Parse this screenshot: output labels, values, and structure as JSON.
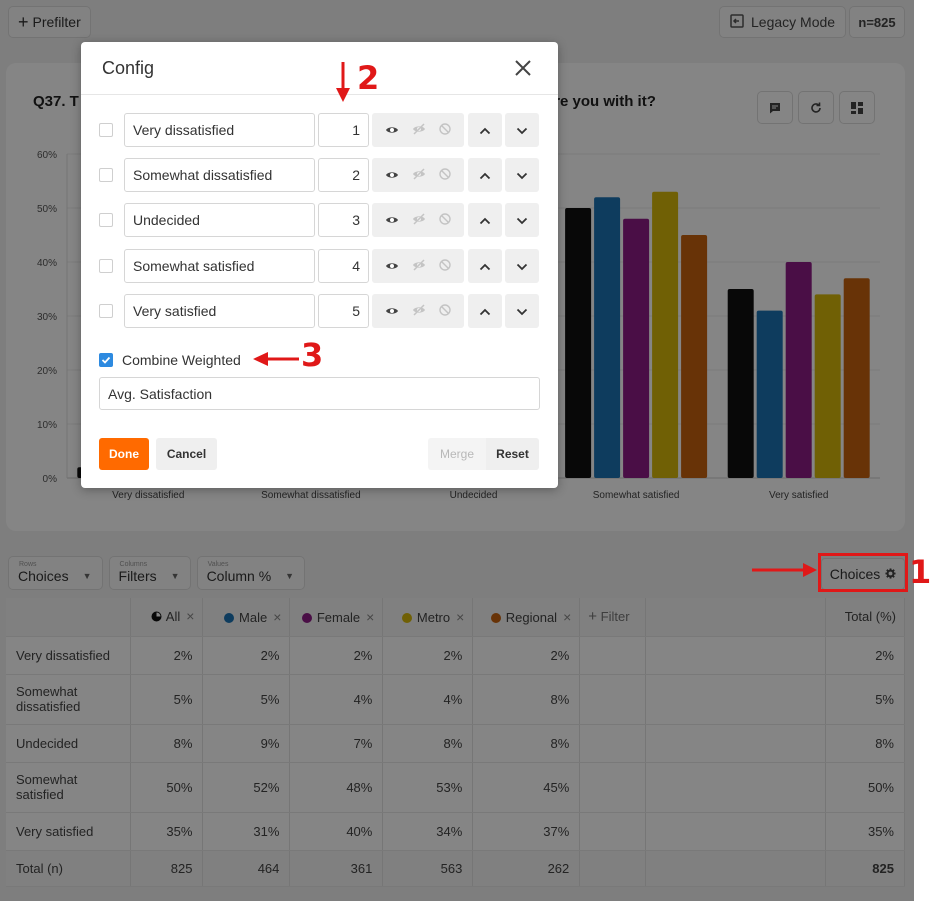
{
  "topbar": {
    "prefilter_label": "Prefilter",
    "legacy_label": "Legacy Mode",
    "n_badge": "n=825"
  },
  "question": {
    "title_visible_left": "Q37. T",
    "title_visible_right": "d were you with it?"
  },
  "chart_data": {
    "type": "bar",
    "categories": [
      "Very dissatisfied",
      "Somewhat dissatisfied",
      "Undecided",
      "Somewhat satisfied",
      "Very satisfied"
    ],
    "ylim": [
      0,
      60
    ],
    "yticks": [
      "0%",
      "10%",
      "20%",
      "30%",
      "40%",
      "50%",
      "60%"
    ],
    "grid": true,
    "series": [
      {
        "name": "All",
        "color": "#111111",
        "values": [
          2,
          5,
          8,
          50,
          35
        ]
      },
      {
        "name": "Male",
        "color": "#1c74b4",
        "values": [
          2,
          5,
          9,
          52,
          31
        ]
      },
      {
        "name": "Female",
        "color": "#8e1b86",
        "values": [
          2,
          4,
          7,
          48,
          40
        ]
      },
      {
        "name": "Metro",
        "color": "#d6b90a",
        "values": [
          2,
          4,
          8,
          53,
          34
        ]
      },
      {
        "name": "Regional",
        "color": "#c7620f",
        "values": [
          2,
          8,
          8,
          45,
          37
        ]
      }
    ]
  },
  "pivot": {
    "rows": {
      "small": "Rows",
      "value": "Choices"
    },
    "columns": {
      "small": "Columns",
      "value": "Filters"
    },
    "values": {
      "small": "Values",
      "value": "Column %"
    },
    "choices_button": "Choices"
  },
  "table": {
    "headers": [
      {
        "label": "All",
        "color": "#111111"
      },
      {
        "label": "Male",
        "color": "#1c74b4"
      },
      {
        "label": "Female",
        "color": "#8e1b86"
      },
      {
        "label": "Metro",
        "color": "#d6b90a"
      },
      {
        "label": "Regional",
        "color": "#c7620f"
      }
    ],
    "filter_label": "Filter",
    "total_header": "Total (%)",
    "rows": [
      {
        "label": "Very dissatisfied",
        "values": [
          "2%",
          "2%",
          "2%",
          "2%",
          "2%"
        ],
        "total": "2%"
      },
      {
        "label": "Somewhat dissatisfied",
        "values": [
          "5%",
          "5%",
          "4%",
          "4%",
          "8%"
        ],
        "total": "5%"
      },
      {
        "label": "Undecided",
        "values": [
          "8%",
          "9%",
          "7%",
          "8%",
          "8%"
        ],
        "total": "8%"
      },
      {
        "label": "Somewhat satisfied",
        "values": [
          "50%",
          "52%",
          "48%",
          "53%",
          "45%"
        ],
        "total": "50%"
      },
      {
        "label": "Very satisfied",
        "values": [
          "35%",
          "31%",
          "40%",
          "34%",
          "37%"
        ],
        "total": "35%"
      },
      {
        "label": "Total (n)",
        "values": [
          "825",
          "464",
          "361",
          "563",
          "262"
        ],
        "total": "825"
      }
    ]
  },
  "modal": {
    "title": "Config",
    "choices": [
      {
        "label": "Very dissatisfied",
        "weight": "1"
      },
      {
        "label": "Somewhat dissatisfied",
        "weight": "2"
      },
      {
        "label": "Undecided",
        "weight": "3"
      },
      {
        "label": "Somewhat satisfied",
        "weight": "4"
      },
      {
        "label": "Very satisfied",
        "weight": "5"
      }
    ],
    "combine_label": "Combine Weighted",
    "combine_value": "Avg. Satisfaction",
    "done_label": "Done",
    "cancel_label": "Cancel",
    "merge_label": "Merge",
    "reset_label": "Reset"
  },
  "annotations": {
    "one": "1",
    "two": "2",
    "three": "3",
    "color": "#e01818"
  }
}
